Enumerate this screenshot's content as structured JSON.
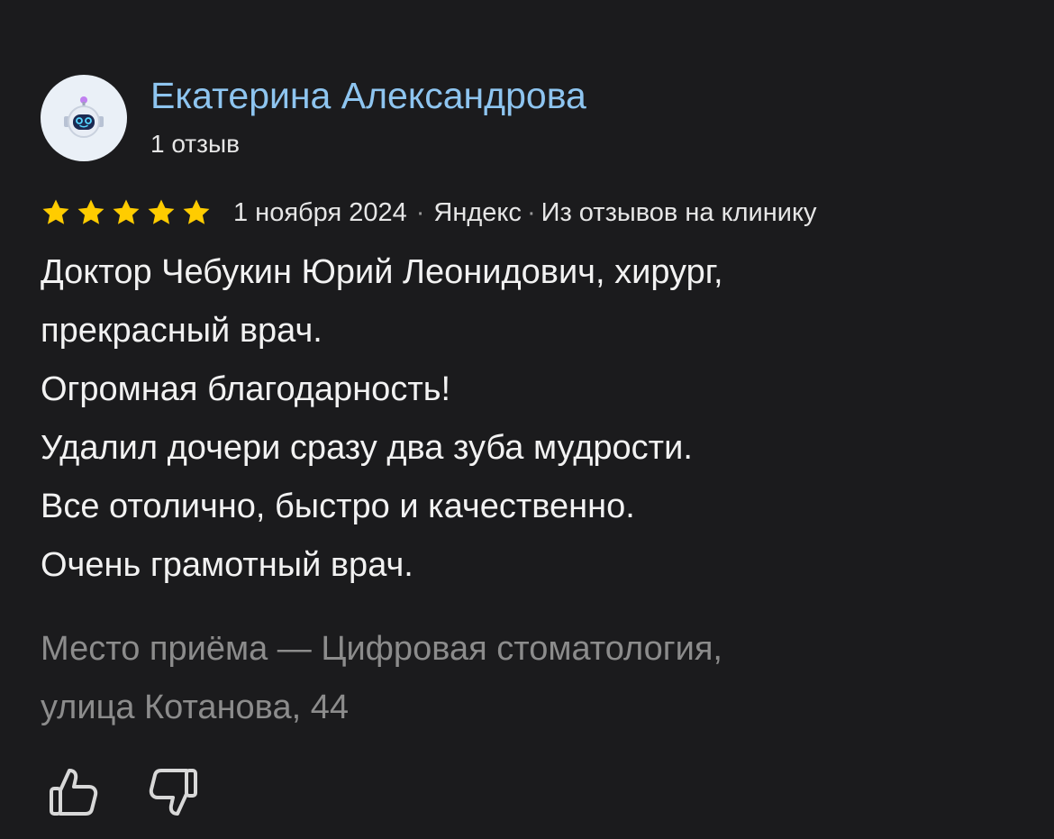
{
  "author": {
    "name": "Екатерина Александрова",
    "reviews_count": "1 отзыв",
    "avatar_icon": "robot-avatar-icon"
  },
  "rating": {
    "stars": 5,
    "max": 5,
    "color": "#ffcc00"
  },
  "meta": {
    "date": "1 ноября 2024",
    "separator": "·",
    "source": "Яндекс",
    "origin": "Из отзывов на клинику"
  },
  "review": {
    "lines": [
      "Доктор Чебукин Юрий Леонидович, хирург,",
      "прекрасный врач.",
      "Огромная благодарность!",
      "Удалил дочери сразу два зуба мудрости.",
      "Все отолично, быстро и качественно.",
      "Очень грамотный врач."
    ]
  },
  "place": {
    "lines": [
      "Место приёма — Цифровая стоматология,",
      "улица Котанова, 44"
    ]
  },
  "actions": {
    "like_icon": "thumbs-up-icon",
    "dislike_icon": "thumbs-down-icon"
  },
  "colors": {
    "background": "#1b1b1d",
    "author_link": "#8ec5f0",
    "muted_text": "#8c8c8c",
    "star": "#ffcc00"
  }
}
